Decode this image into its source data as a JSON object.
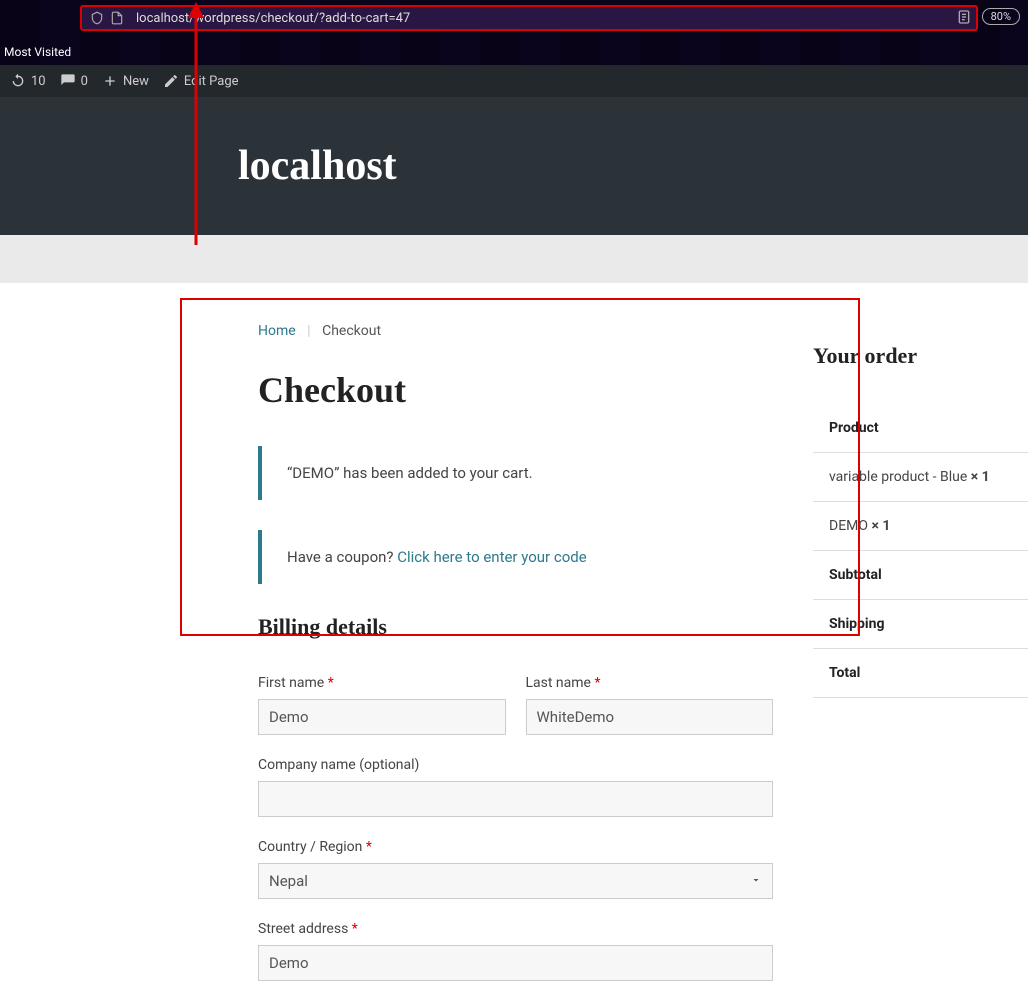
{
  "browser": {
    "url": "localhost/wordpress/checkout/?add-to-cart=47",
    "zoom": "80%",
    "most_visited": "Most Visited"
  },
  "admin_bar": {
    "updates": "10",
    "comments": "0",
    "new_label": "New",
    "edit_label": "Edit Page"
  },
  "site": {
    "title": "localhost"
  },
  "breadcrumb": {
    "home": "Home",
    "current": "Checkout"
  },
  "page": {
    "title": "Checkout"
  },
  "notices": {
    "added": "“DEMO” has been added to your cart.",
    "coupon_q": "Have a coupon? ",
    "coupon_link": "Click here to enter your code"
  },
  "billing": {
    "heading": "Billing details",
    "first_name_label": "First name ",
    "last_name_label": "Last name ",
    "first_name_value": "Demo",
    "last_name_value": "WhiteDemo",
    "company_label": "Company name (optional)",
    "company_value": "",
    "country_label": "Country / Region ",
    "country_value": "Nepal",
    "street_label": "Street address ",
    "street_value": "Demo"
  },
  "order": {
    "heading": "Your order",
    "product_header": "Product",
    "items": [
      {
        "name": "variable product - Blue ",
        "qty": "× 1"
      },
      {
        "name": "DEMO ",
        "qty": "× 1"
      }
    ],
    "subtotal_label": "Subtotal",
    "shipping_label": "Shipping",
    "total_label": "Total"
  }
}
